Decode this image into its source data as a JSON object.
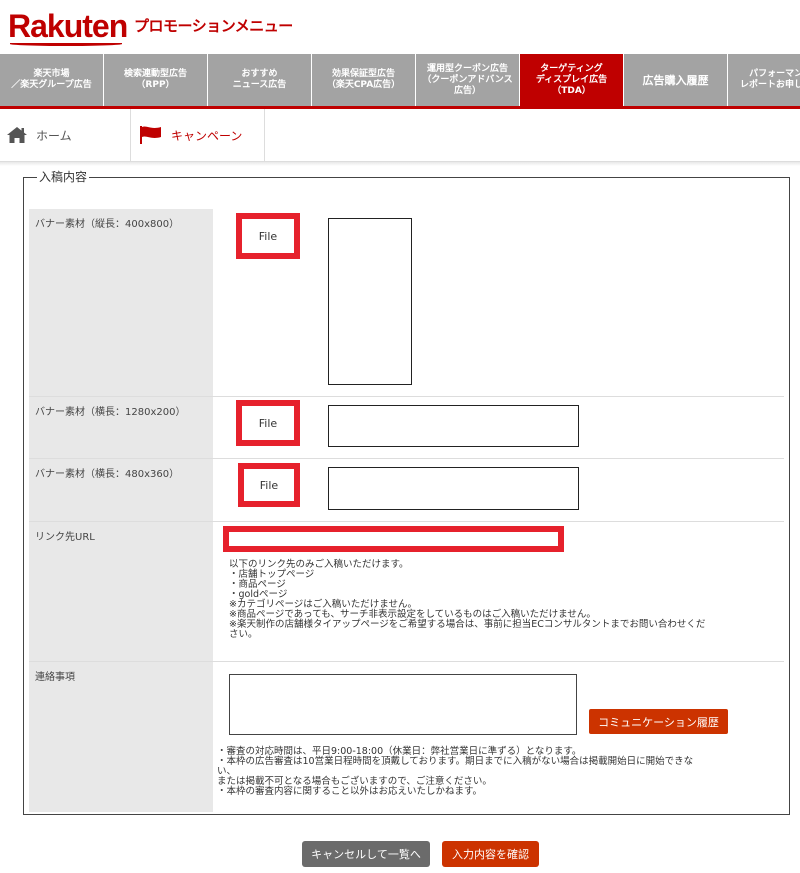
{
  "header": {
    "logo": "Rakuten",
    "app_title": "プロモーションメニュー"
  },
  "nav": {
    "tabs": [
      {
        "label": "楽天市場\n／楽天グループ広告",
        "active": false
      },
      {
        "label": "検索連動型広告\n（RPP）",
        "active": false
      },
      {
        "label": "おすすめ\nニュース広告",
        "active": false
      },
      {
        "label": "効果保証型広告\n（楽天CPA広告）",
        "active": false
      },
      {
        "label": "運用型クーポン広告\n（クーポンアドバンス\n広告）",
        "active": false
      },
      {
        "label": "ターゲティング\nディスプレイ広告\n（TDA）",
        "active": true
      },
      {
        "label": "広告購入履歴",
        "active": false
      },
      {
        "label": "パフォーマンス\nレポートお申し込み",
        "active": false
      }
    ]
  },
  "breadcrumb": {
    "home": "ホーム",
    "campaign": "キャンペーン"
  },
  "form": {
    "legend": "入稿内容",
    "banner_portrait_label": "バナー素材（縦長：400x800）",
    "banner_landscape_label": "バナー素材（横長：1280x200）",
    "banner_480_label": "バナー素材（横長：480x360）",
    "file_button": "File",
    "link_url_label": "リンク先URL",
    "link_url_notes": "以下のリンク先のみご入稿いただけます。\n・店舗トップページ\n・商品ページ\n・goldページ\n※カテゴリページはご入稿いただけません。\n※商品ページであっても、サーチ非表示設定をしているものはご入稿いただけません。\n※楽天制作の店舗様タイアップページをご希望する場合は、事前に担当ECコンサルタントまでお問い合わせくだ\nさい。",
    "contact_label": "連絡事項",
    "history_button": "コミュニケーション履歴",
    "contact_notes": "・審査の対応時間は、平日9:00-18:00（休業日：弊社営業日に準ずる）となります。\n・本枠の広告審査は10営業日程時間を頂戴しております。期日までに入稿がない場合は掲載開始日に開始できな\nい、\nまたは掲載不可となる場合もございますので、ご注意ください。\n・本枠の審査内容に関すること以外はお応えいたしかねます。"
  },
  "footer": {
    "cancel_button": "キャンセルして一覧へ",
    "confirm_button": "入力内容を確認"
  },
  "colors": {
    "brand_red": "#bf0000",
    "highlight_red": "#e6212c",
    "action_orange": "#cc3300",
    "nav_gray": "#a3a3a3"
  }
}
